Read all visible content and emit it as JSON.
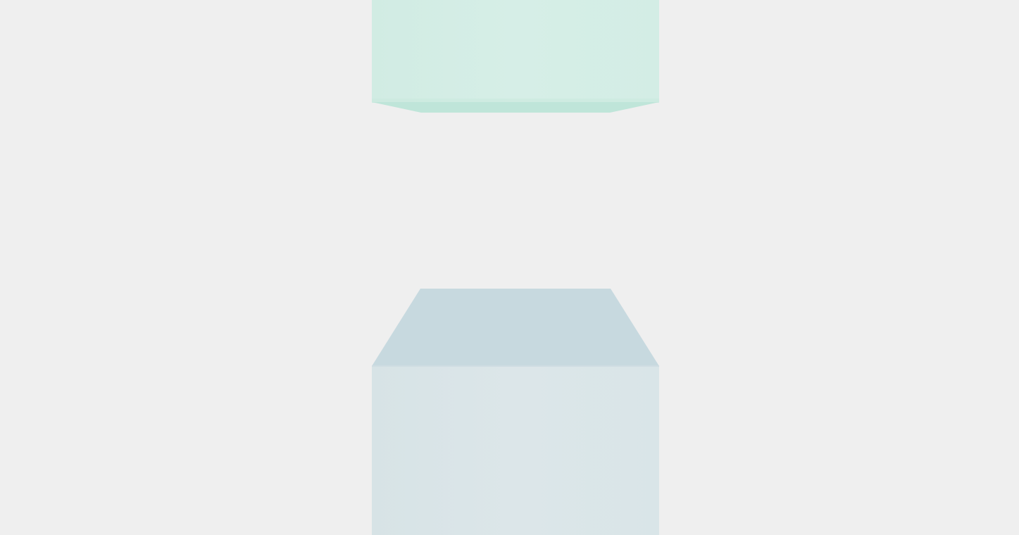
{
  "theme": {
    "background": "#efefef",
    "top_block": {
      "front": "#d3ede5",
      "front_highlight": "#d8efe8",
      "lower_face": "#bfe5d9",
      "shade": "#c8e8dd"
    },
    "bottom_block": {
      "top_face": "#c7d9df",
      "front": "#d9e5e8",
      "front_highlight": "#dde7ea"
    }
  }
}
